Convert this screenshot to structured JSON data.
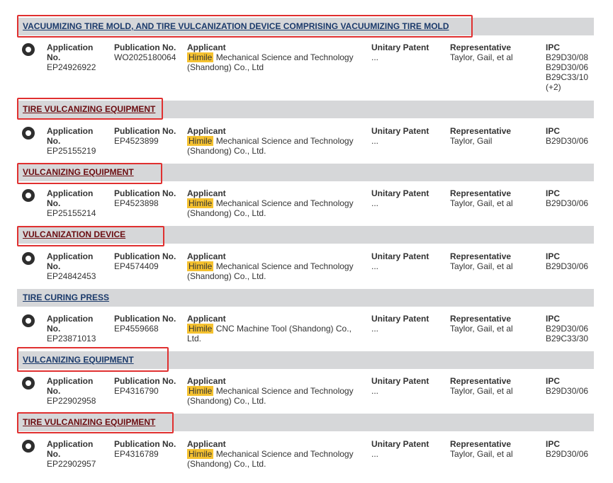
{
  "columns": {
    "application": "Application No.",
    "publication": "Publication No.",
    "applicant": "Applicant",
    "unitary": "Unitary Patent",
    "representative": "Representative",
    "ipc": "IPC"
  },
  "records": [
    {
      "title": "VACUUMIZING TIRE MOLD, AND TIRE VULCANIZATION DEVICE COMPRISING VACUUMIZING TIRE MOLD",
      "application_no": "EP24926922",
      "publication_no": "WO2025180064",
      "applicant_highlight": "Himile",
      "applicant_rest": "Mechanical Science and Technology (Shandong) Co., Ltd",
      "unitary": "...",
      "representative": "Taylor, Gail, et al",
      "ipc": "B29D30/08\nB29D30/06\nB29C33/10\n(+2)"
    },
    {
      "title": "TIRE VULCANIZING EQUIPMENT",
      "application_no": "EP25155219",
      "publication_no": "EP4523899",
      "applicant_highlight": "Himile",
      "applicant_rest": "Mechanical Science and Technology (Shandong) Co., Ltd.",
      "unitary": "...",
      "representative": "Taylor, Gail",
      "ipc": "B29D30/06"
    },
    {
      "title": "VULCANIZING EQUIPMENT",
      "application_no": "EP25155214",
      "publication_no": "EP4523898",
      "applicant_highlight": "Himile",
      "applicant_rest": "Mechanical Science and Technology (Shandong) Co., Ltd.",
      "unitary": "...",
      "representative": "Taylor, Gail, et al",
      "ipc": "B29D30/06"
    },
    {
      "title": "VULCANIZATION DEVICE",
      "application_no": "EP24842453",
      "publication_no": "EP4574409",
      "applicant_highlight": "Himile",
      "applicant_rest": "Mechanical Science and Technology (Shandong) Co., Ltd.",
      "unitary": "...",
      "representative": "Taylor, Gail, et al",
      "ipc": "B29D30/06"
    },
    {
      "title": "TIRE CURING PRESS",
      "application_no": "EP23871013",
      "publication_no": "EP4559668",
      "applicant_highlight": "Himile",
      "applicant_rest": "CNC Machine Tool (Shandong) Co., Ltd.",
      "unitary": "...",
      "representative": "Taylor, Gail, et al",
      "ipc": "B29D30/06\nB29C33/30"
    },
    {
      "title": "VULCANIZING EQUIPMENT",
      "application_no": "EP22902958",
      "publication_no": "EP4316790",
      "applicant_highlight": "Himile",
      "applicant_rest": "Mechanical Science and Technology (Shandong) Co., Ltd.",
      "unitary": "...",
      "representative": "Taylor, Gail, et al",
      "ipc": "B29D30/06"
    },
    {
      "title": "TIRE VULCANIZING EQUIPMENT",
      "application_no": "EP22902957",
      "publication_no": "EP4316789",
      "applicant_highlight": "Himile",
      "applicant_rest": "Mechanical Science and Technology (Shandong) Co., Ltd.",
      "unitary": "...",
      "representative": "Taylor, Gail, et al",
      "ipc": "B29D30/06"
    }
  ],
  "colors": {
    "title_bar": "#d6d7d9",
    "link": "#1b3a6b",
    "visited_link": "#6b0d11",
    "highlight": "#f5c230",
    "annotation_box": "#e03030"
  }
}
